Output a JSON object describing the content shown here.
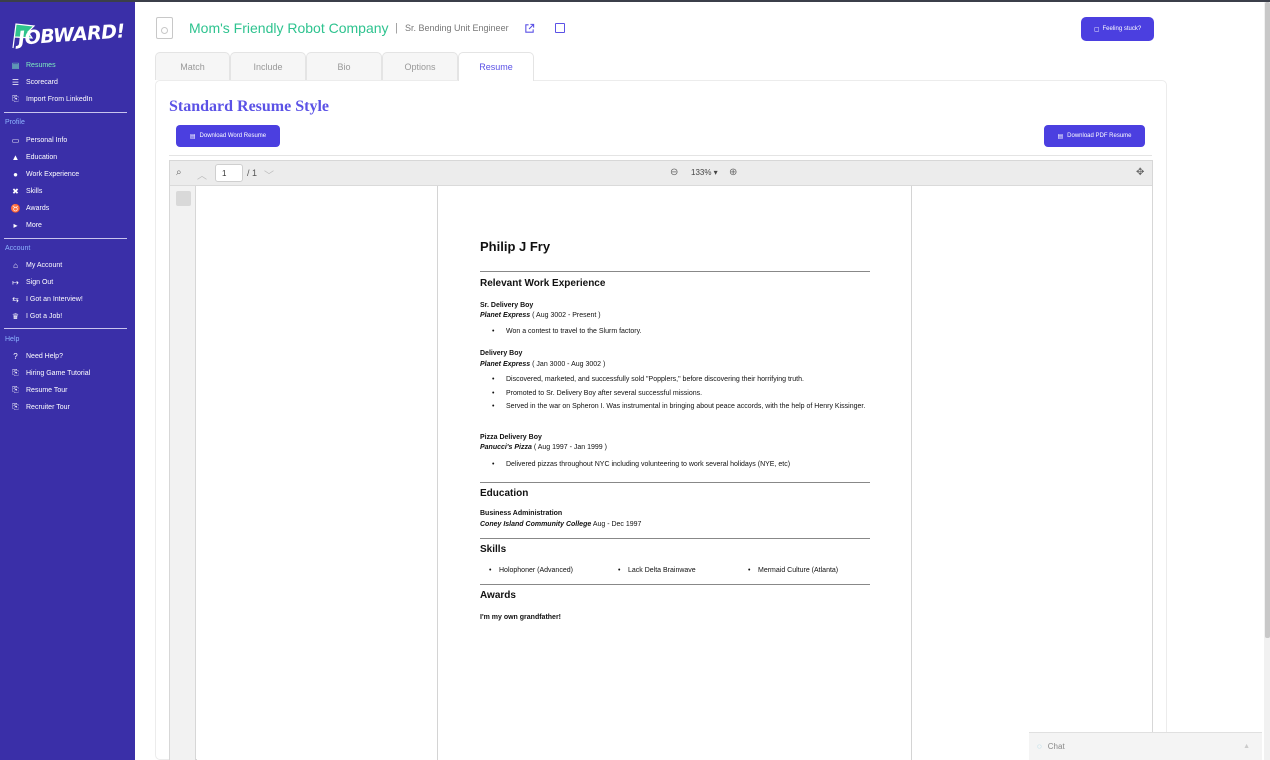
{
  "app": {
    "brand": "JOBWARD!"
  },
  "sidebar": {
    "main": [
      {
        "label": "Resumes",
        "icon": "resume-icon"
      },
      {
        "label": "Scorecard",
        "icon": "list-icon"
      },
      {
        "label": "Import From LinkedIn",
        "icon": "file-import-icon"
      }
    ],
    "profile_label": "Profile",
    "profile": [
      {
        "label": "Personal Info",
        "icon": "id-card-icon"
      },
      {
        "label": "Education",
        "icon": "graduation-cap-icon"
      },
      {
        "label": "Work Experience",
        "icon": "briefcase-icon"
      },
      {
        "label": "Skills",
        "icon": "tools-icon"
      },
      {
        "label": "Awards",
        "icon": "medal-icon"
      },
      {
        "label": "More",
        "icon": "caret-right-icon"
      }
    ],
    "account_label": "Account",
    "account": [
      {
        "label": "My Account",
        "icon": "home-icon"
      },
      {
        "label": "Sign Out",
        "icon": "sign-out-icon"
      },
      {
        "label": "I Got an Interview!",
        "icon": "handshake-icon"
      },
      {
        "label": "I Got a Job!",
        "icon": "crown-icon"
      }
    ],
    "help_label": "Help",
    "help": [
      {
        "label": "Need Help?",
        "icon": "question-icon"
      },
      {
        "label": "Hiring Game Tutorial",
        "icon": "tour-icon"
      },
      {
        "label": "Resume Tour",
        "icon": "tour-icon"
      },
      {
        "label": "Recruiter Tour",
        "icon": "tour-icon"
      }
    ]
  },
  "header": {
    "company": "Mom's Friendly Robot Company",
    "separator": "|",
    "job_title": "Sr. Bending Unit Engineer",
    "stuck_button": "Feeling stuck?"
  },
  "tabs": [
    "Match",
    "Include",
    "Bio",
    "Options",
    "Resume"
  ],
  "main": {
    "style_title": "Standard Resume Style",
    "download_word": "Download Word Resume",
    "download_pdf": "Download PDF Resume"
  },
  "viewer": {
    "page": "1",
    "total": "/ 1",
    "zoom": "133% ▾"
  },
  "resume": {
    "name": "Philip J Fry",
    "work_heading": "Relevant Work Experience",
    "jobs": [
      {
        "title": "Sr. Delivery Boy",
        "company": "Planet Express",
        "dates": "( Aug 3002 - Present )",
        "bullets": [
          "Won a contest to travel to the Slurm factory."
        ]
      },
      {
        "title": "Delivery Boy",
        "company": "Planet Express",
        "dates": "( Jan 3000 - Aug 3002 )",
        "bullets": [
          "Discovered, marketed, and successfully sold \"Popplers,\" before discovering their horrifying truth.",
          "Promoted to Sr. Delivery Boy after several successful missions.",
          "Served in the war on Spheron I. Was instrumental in bringing about peace accords, with the help of Henry Kissinger."
        ]
      },
      {
        "title": "Pizza Delivery Boy",
        "company": "Panucci's Pizza",
        "dates": "( Aug 1997 - Jan 1999 )",
        "bullets": [
          "Delivered pizzas throughout NYC including volunteering to work several holidays (NYE, etc)"
        ]
      }
    ],
    "education_heading": "Education",
    "degree": "Business Administration",
    "school": "Coney Island Community College",
    "school_dates": "Aug - Dec 1997",
    "skills_heading": "Skills",
    "skills": [
      "Holophoner (Advanced)",
      "Lack Delta Brainwave",
      "Mermaid Culture (Atlanta)"
    ],
    "awards_heading": "Awards",
    "award": "I'm my own grandfather!"
  },
  "chat": {
    "label": "Chat"
  }
}
